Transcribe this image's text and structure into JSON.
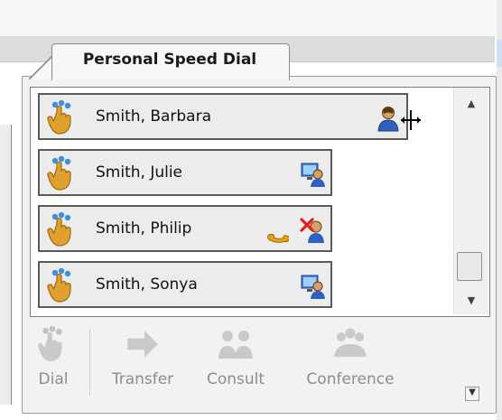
{
  "panel": {
    "tab_title": "Personal Speed Dial"
  },
  "contacts": [
    {
      "name": "Smith, Barbara",
      "status_icon": "user-available-icon"
    },
    {
      "name": "Smith, Julie",
      "status_icon": "user-at-computer-icon"
    },
    {
      "name": "Smith, Philip",
      "status_icon": "user-on-call-unavailable-icon"
    },
    {
      "name": "Smith, Sonya",
      "status_icon": "user-at-computer-icon"
    }
  ],
  "toolbar": {
    "dial_label": "Dial",
    "transfer_label": "Transfer",
    "consult_label": "Consult",
    "conference_label": "Conference"
  },
  "colors": {
    "hand": "#e0a030",
    "blue_dots": "#3f8fe0",
    "phone": "#e7a21a",
    "red_x": "#e02020"
  }
}
